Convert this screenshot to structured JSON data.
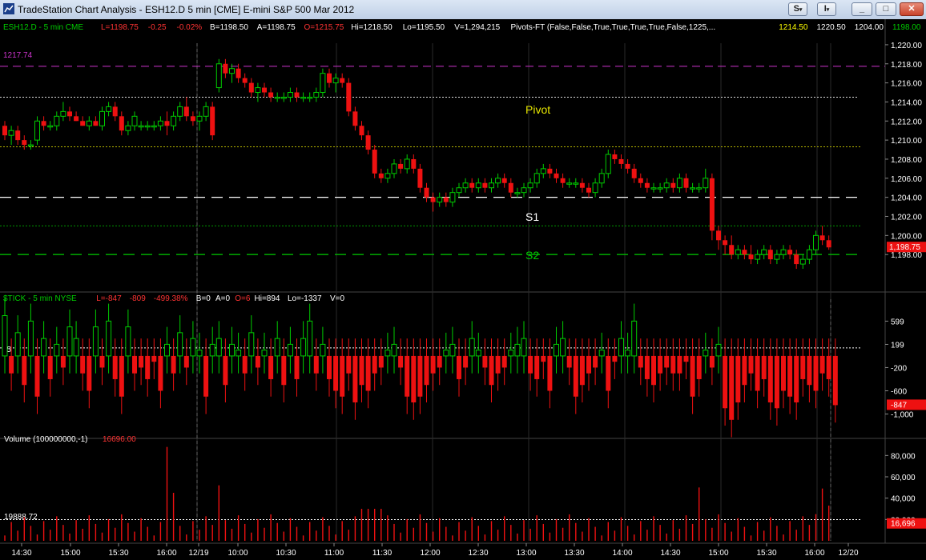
{
  "window": {
    "title": "TradeStation Chart Analysis - ESH12.D 5 min [CME] E-mini S&P 500 Mar 2012",
    "btn_s": "S",
    "btn_i": "I",
    "btn_min": "_",
    "btn_max": "□",
    "btn_close": "✕"
  },
  "price_pane": {
    "header": [
      {
        "text": "ESH12.D - 5 min  CME",
        "color": "#00cc00"
      },
      {
        "text": "L=1198.75",
        "color": "#ff3333"
      },
      {
        "text": "-0.25",
        "color": "#ff3333"
      },
      {
        "text": "-0.02%",
        "color": "#ff3333"
      },
      {
        "text": "B=1198.50",
        "color": "#ffffff"
      },
      {
        "text": "A=1198.75",
        "color": "#ffffff"
      },
      {
        "text": "O=1215.75",
        "color": "#ff3333"
      },
      {
        "text": "Hi=1218.50",
        "color": "#ffffff"
      },
      {
        "text": "Lo=1195.50",
        "color": "#ffffff"
      },
      {
        "text": "V=1,294,215",
        "color": "#ffffff"
      },
      {
        "text": "Pivots-FT (False,False,True,True,True,True,False,1225,...",
        "color": "#ffffff"
      },
      {
        "text": "1214.50",
        "color": "#ffff00"
      },
      {
        "text": "1220.50",
        "color": "#ffffff"
      },
      {
        "text": "1204.00",
        "color": "#ffffff"
      },
      {
        "text": "1198.00",
        "color": "#00cc00"
      },
      {
        "text": "1217",
        "color": "#777700"
      }
    ],
    "line_label_1217": "1217.74",
    "pivot_label": "Pivot",
    "s1_label": "S1",
    "s2_label": "S2",
    "last_price_tag": "1,198.75",
    "axis_ticks": [
      "1,220.00",
      "1,218.00",
      "1,216.00",
      "1,214.00",
      "1,212.00",
      "1,210.00",
      "1,208.00",
      "1,206.00",
      "1,204.00",
      "1,202.00",
      "1,200.00",
      "1,198.00"
    ]
  },
  "tick_pane": {
    "header": [
      {
        "text": "$TICK - 5 min  NYSE",
        "color": "#00cc00"
      },
      {
        "text": "L=-847",
        "color": "#ff3333"
      },
      {
        "text": "-809",
        "color": "#ff3333"
      },
      {
        "text": "-499.38%",
        "color": "#ff3333"
      },
      {
        "text": "B=0",
        "color": "#ffffff"
      },
      {
        "text": "A=0",
        "color": "#ffffff"
      },
      {
        "text": "O=6",
        "color": "#ff3333"
      },
      {
        "text": "Hi=894",
        "color": "#ffffff"
      },
      {
        "text": "Lo=-1337",
        "color": "#ffffff"
      },
      {
        "text": "V=0",
        "color": "#ffffff"
      }
    ],
    "zero_label": "-5",
    "last_tag": "-847",
    "axis_ticks": [
      "599",
      "199",
      "-200",
      "-600",
      "-1,000"
    ]
  },
  "volume_pane": {
    "header_name": "Volume (100000000,-1)",
    "header_value": "16696.00",
    "avg_label": "19888.72",
    "last_tag": "16,696",
    "axis_ticks": [
      "80,000",
      "60,000",
      "40,000",
      "20,000"
    ]
  },
  "time_axis": [
    "14:30",
    "15:00",
    "15:30",
    "16:00",
    "12/19",
    "10:00",
    "10:30",
    "11:00",
    "11:30",
    "12:00",
    "12:30",
    "13:00",
    "13:30",
    "14:00",
    "14:30",
    "15:00",
    "15:30",
    "16:00",
    "12/20"
  ],
  "colors": {
    "up": "#00cc00",
    "down": "#ee1111",
    "pivot": "#e8e800",
    "s1": "#ffffff",
    "s2": "#00cc00",
    "magenta": "#cc33cc"
  },
  "chart_data": {
    "type": "candlestick",
    "bar_interval": "5 min",
    "price_ylim": [
      1196,
      1221
    ],
    "tick_ylim": [
      -1337,
      894
    ],
    "volume_ylim": [
      0,
      90000
    ],
    "levels": {
      "magenta": 1217.74,
      "r1": 1214.5,
      "pivot": 1209.3,
      "s1": 1204.0,
      "s2": 1198.0,
      "upper_dotted": 1201.0
    },
    "price_ohlc": [
      [
        1211.5,
        1212,
        1210,
        1210.5
      ],
      [
        1210.5,
        1211.5,
        1209.5,
        1211
      ],
      [
        1211,
        1211.5,
        1209.5,
        1210
      ],
      [
        1210,
        1210.5,
        1209,
        1209.5
      ],
      [
        1209.5,
        1210,
        1209,
        1209.5
      ],
      [
        1210,
        1212.5,
        1209.5,
        1212
      ],
      [
        1212,
        1212.5,
        1211,
        1211.5
      ],
      [
        1211.5,
        1212,
        1211,
        1211.5
      ],
      [
        1211.5,
        1213,
        1211,
        1212.5
      ],
      [
        1212.5,
        1214,
        1212,
        1213
      ],
      [
        1213,
        1213.5,
        1212,
        1212.5
      ],
      [
        1212.5,
        1213,
        1212,
        1212
      ],
      [
        1212,
        1212.5,
        1211.5,
        1211.5
      ],
      [
        1211.5,
        1212.5,
        1211,
        1212
      ],
      [
        1212,
        1212.5,
        1211.5,
        1211.5
      ],
      [
        1211.5,
        1213.5,
        1211,
        1213
      ],
      [
        1213,
        1214,
        1212.5,
        1213.5
      ],
      [
        1213.5,
        1214,
        1212,
        1212.5
      ],
      [
        1212.5,
        1213,
        1210.5,
        1211
      ],
      [
        1211,
        1212,
        1210.5,
        1211.5
      ],
      [
        1211.5,
        1213,
        1211,
        1212.5
      ],
      [
        1211.5,
        1212,
        1211,
        1211.5
      ],
      [
        1211.5,
        1212,
        1211,
        1211.5
      ],
      [
        1211.5,
        1212,
        1211,
        1211.5
      ],
      [
        1211.5,
        1212.5,
        1211,
        1212
      ],
      [
        1212,
        1213,
        1210.5,
        1211.5
      ],
      [
        1211.5,
        1213,
        1211,
        1212.5
      ],
      [
        1212.5,
        1214,
        1212,
        1213.5
      ],
      [
        1213.5,
        1214.5,
        1212,
        1212.5
      ],
      [
        1212.5,
        1213,
        1211.5,
        1212
      ],
      [
        1212,
        1213,
        1211,
        1212.5
      ],
      [
        1212.5,
        1214,
        1212,
        1213.5
      ],
      [
        1213.5,
        1214,
        1210,
        1210.5
      ],
      [
        1215.5,
        1218.5,
        1215,
        1218
      ],
      [
        1218,
        1218.5,
        1216.5,
        1217
      ],
      [
        1217,
        1218,
        1216,
        1217.5
      ],
      [
        1217.5,
        1218,
        1216,
        1216.5
      ],
      [
        1216.5,
        1217,
        1215.5,
        1216
      ],
      [
        1216,
        1216.5,
        1214.5,
        1215
      ],
      [
        1215,
        1216,
        1214,
        1215.5
      ],
      [
        1215.5,
        1216,
        1214.5,
        1215
      ],
      [
        1215,
        1215.5,
        1214,
        1214.5
      ],
      [
        1214.5,
        1215,
        1214,
        1214.5
      ],
      [
        1214.5,
        1215,
        1214,
        1214.5
      ],
      [
        1214.5,
        1215.5,
        1214,
        1215
      ],
      [
        1215,
        1215.5,
        1214,
        1214.5
      ],
      [
        1214.5,
        1215,
        1214,
        1214.5
      ],
      [
        1214.5,
        1215,
        1214,
        1214.5
      ],
      [
        1214.5,
        1215.5,
        1214,
        1215
      ],
      [
        1215,
        1217.5,
        1214.5,
        1217
      ],
      [
        1217,
        1217.5,
        1215.5,
        1216
      ],
      [
        1216,
        1217,
        1215,
        1216.5
      ],
      [
        1216.5,
        1217,
        1215.5,
        1216
      ],
      [
        1216,
        1216.5,
        1212.5,
        1213
      ],
      [
        1213,
        1213.5,
        1211,
        1211.5
      ],
      [
        1211.5,
        1212,
        1210,
        1210.5
      ],
      [
        1210.5,
        1211,
        1208.5,
        1209
      ],
      [
        1209,
        1209.5,
        1206,
        1206.5
      ],
      [
        1206.5,
        1207,
        1205.5,
        1206
      ],
      [
        1206,
        1207,
        1205.5,
        1206.5
      ],
      [
        1206.5,
        1208,
        1206,
        1207.5
      ],
      [
        1207.5,
        1208,
        1206.5,
        1207
      ],
      [
        1207,
        1208.5,
        1206.5,
        1208
      ],
      [
        1208,
        1208.5,
        1206.5,
        1207
      ],
      [
        1207,
        1207.5,
        1204.5,
        1205
      ],
      [
        1205,
        1205.5,
        1203.5,
        1204
      ],
      [
        1204,
        1204.5,
        1202.5,
        1203.5
      ],
      [
        1203.5,
        1204.5,
        1203,
        1204
      ],
      [
        1204,
        1204.5,
        1203,
        1203.5
      ],
      [
        1203.5,
        1205,
        1203,
        1204.5
      ],
      [
        1204.5,
        1205.5,
        1204,
        1205
      ],
      [
        1205,
        1206,
        1204.5,
        1205.5
      ],
      [
        1205.5,
        1206,
        1204.5,
        1205
      ],
      [
        1205,
        1206,
        1204.5,
        1205.5
      ],
      [
        1205.5,
        1206,
        1204.5,
        1205
      ],
      [
        1205,
        1206,
        1204.5,
        1205.5
      ],
      [
        1205.5,
        1206.5,
        1205,
        1206
      ],
      [
        1206,
        1206.5,
        1205,
        1205.5
      ],
      [
        1205.5,
        1206,
        1204,
        1204.5
      ],
      [
        1204.5,
        1205,
        1204,
        1204.5
      ],
      [
        1204.5,
        1205.5,
        1204,
        1205
      ],
      [
        1205,
        1206,
        1204.5,
        1205.5
      ],
      [
        1205.5,
        1207,
        1205,
        1206.5
      ],
      [
        1206.5,
        1207.5,
        1206,
        1207
      ],
      [
        1207,
        1207.5,
        1206,
        1206.5
      ],
      [
        1206.5,
        1207,
        1205.5,
        1206
      ],
      [
        1206,
        1206.5,
        1205,
        1205.5
      ],
      [
        1205.5,
        1206,
        1205,
        1205.5
      ],
      [
        1205.5,
        1206,
        1205,
        1205.5
      ],
      [
        1205.5,
        1206,
        1204.5,
        1205
      ],
      [
        1205,
        1205.5,
        1204,
        1204.5
      ],
      [
        1204.5,
        1206,
        1204,
        1205.5
      ],
      [
        1205.5,
        1207,
        1205,
        1206.5
      ],
      [
        1206.5,
        1209,
        1206,
        1208.5
      ],
      [
        1208.5,
        1209,
        1207.5,
        1208
      ],
      [
        1208,
        1208.5,
        1207,
        1207.5
      ],
      [
        1207.5,
        1208,
        1206.5,
        1207
      ],
      [
        1207,
        1207.5,
        1205.5,
        1206
      ],
      [
        1206,
        1206.5,
        1205,
        1205.5
      ],
      [
        1205.5,
        1206,
        1204.5,
        1205
      ],
      [
        1205,
        1205.5,
        1204.5,
        1205
      ],
      [
        1205,
        1205.5,
        1204.5,
        1205
      ],
      [
        1205,
        1206,
        1204.5,
        1205.5
      ],
      [
        1205.5,
        1206,
        1204.5,
        1205
      ],
      [
        1205,
        1206.5,
        1204.5,
        1206
      ],
      [
        1206,
        1206.5,
        1204.5,
        1205
      ],
      [
        1205,
        1205.5,
        1204.5,
        1205
      ],
      [
        1205,
        1205.5,
        1204.5,
        1205
      ],
      [
        1205,
        1207,
        1204.5,
        1206
      ],
      [
        1206,
        1206.5,
        1199.5,
        1200.5
      ],
      [
        1200.5,
        1201,
        1198.5,
        1199.5
      ],
      [
        1199.5,
        1200,
        1198,
        1199
      ],
      [
        1199,
        1200,
        1197.5,
        1198
      ],
      [
        1198,
        1199,
        1197.5,
        1198.5
      ],
      [
        1198.5,
        1199,
        1197.5,
        1198
      ],
      [
        1198,
        1199,
        1197,
        1197.5
      ],
      [
        1197.5,
        1198.5,
        1197,
        1198
      ],
      [
        1198,
        1199,
        1197.5,
        1198.5
      ],
      [
        1198.5,
        1199,
        1197,
        1197.5
      ],
      [
        1197.5,
        1198.5,
        1197,
        1198
      ],
      [
        1198,
        1199,
        1197.5,
        1198.5
      ],
      [
        1198.5,
        1199,
        1197.5,
        1198
      ],
      [
        1198,
        1198.5,
        1196.5,
        1197
      ],
      [
        1197,
        1198,
        1196.5,
        1197.5
      ],
      [
        1197.5,
        1199,
        1197,
        1198.5
      ],
      [
        1198.5,
        1200.5,
        1198,
        1200
      ],
      [
        1200,
        1201,
        1199,
        1199.5
      ],
      [
        1199.5,
        1200,
        1198.5,
        1198.75
      ]
    ],
    "tick_values": [
      694,
      -300,
      400,
      -500,
      600,
      -700,
      300,
      -400,
      200,
      -200,
      500,
      300,
      -300,
      -600,
      500,
      -200,
      600,
      -400,
      -700,
      500,
      -300,
      -200,
      -400,
      -100,
      -600,
      200,
      -300,
      400,
      -200,
      300,
      100,
      -700,
      200,
      300,
      -500,
      200,
      100,
      -300,
      400,
      -200,
      100,
      -400,
      300,
      -500,
      200,
      -400,
      300,
      600,
      -300,
      200,
      -400,
      -600,
      -700,
      -300,
      -800,
      -500,
      -600,
      -300,
      -200,
      100,
      200,
      -200,
      -700,
      -800,
      -700,
      -500,
      -300,
      -200,
      100,
      200,
      -400,
      -200,
      300,
      100,
      -200,
      -500,
      -300,
      -200,
      100,
      200,
      300,
      -300,
      -400,
      -100,
      -600,
      200,
      300,
      -200,
      -700,
      -500,
      -300,
      -200,
      100,
      -600,
      -100,
      300,
      100,
      600,
      -200,
      -400,
      -500,
      -300,
      -200,
      -300,
      -300,
      -100,
      -700,
      -400,
      100,
      -200,
      200,
      -900,
      -1100,
      -800,
      -500,
      -300,
      -600,
      -400,
      -800,
      -900,
      -600,
      -700,
      -800,
      -400,
      -500,
      -600,
      -300,
      -400,
      -847
    ]
  }
}
